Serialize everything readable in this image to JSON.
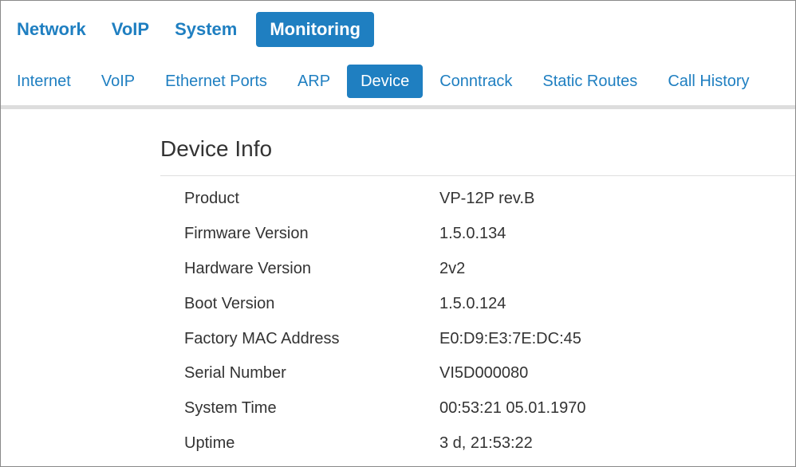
{
  "top_nav": {
    "items": [
      {
        "label": "Network",
        "active": false
      },
      {
        "label": "VoIP",
        "active": false
      },
      {
        "label": "System",
        "active": false
      },
      {
        "label": "Monitoring",
        "active": true
      }
    ]
  },
  "sub_nav": {
    "items": [
      {
        "label": "Internet",
        "active": false
      },
      {
        "label": "VoIP",
        "active": false
      },
      {
        "label": "Ethernet Ports",
        "active": false
      },
      {
        "label": "ARP",
        "active": false
      },
      {
        "label": "Device",
        "active": true
      },
      {
        "label": "Conntrack",
        "active": false
      },
      {
        "label": "Static Routes",
        "active": false
      },
      {
        "label": "Call History",
        "active": false
      }
    ]
  },
  "device_info": {
    "title": "Device Info",
    "rows": [
      {
        "label": "Product",
        "value": "VP-12P rev.B"
      },
      {
        "label": "Firmware Version",
        "value": "1.5.0.134"
      },
      {
        "label": "Hardware Version",
        "value": "2v2"
      },
      {
        "label": "Boot Version",
        "value": "1.5.0.124"
      },
      {
        "label": "Factory MAC Address",
        "value": "E0:D9:E3:7E:DC:45"
      },
      {
        "label": "Serial Number",
        "value": "VI5D000080"
      },
      {
        "label": "System Time",
        "value": "00:53:21 05.01.1970"
      },
      {
        "label": "Uptime",
        "value": "3 d, 21:53:22"
      }
    ]
  },
  "colors": {
    "accent": "#1f7fc1",
    "text": "#333333",
    "divider": "#dddddd"
  }
}
